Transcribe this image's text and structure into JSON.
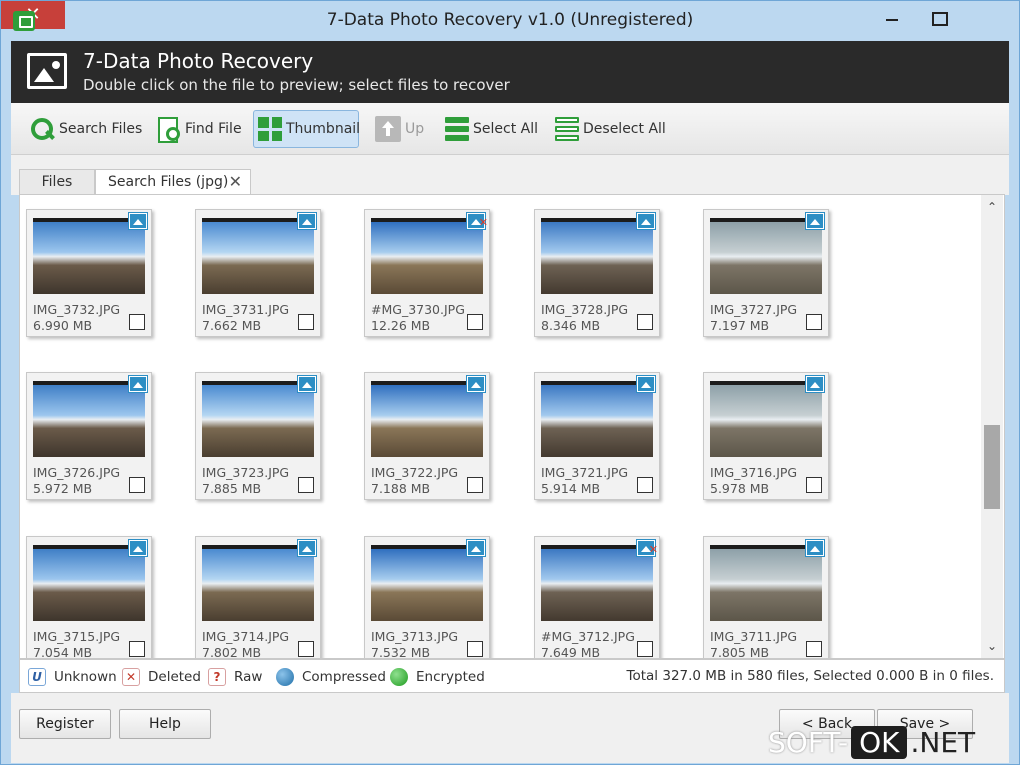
{
  "window": {
    "title": "7-Data Photo Recovery v1.0 (Unregistered)",
    "close_glyph": "✕"
  },
  "banner": {
    "title": "7-Data Photo Recovery",
    "subtitle": "Double click on the file to preview; select files to recover"
  },
  "toolbar": {
    "search_files": "Search Files",
    "find_file": "Find File",
    "thumbnail": "Thumbnail",
    "up": "Up",
    "select_all": "Select All",
    "deselect_all": "Deselect All"
  },
  "tabs": {
    "files": "Files",
    "search": "Search Files (jpg)",
    "close_glyph": "✕"
  },
  "thumbnails": [
    {
      "name": "IMG_3732.JPG",
      "size": "6.990 MB"
    },
    {
      "name": "IMG_3731.JPG",
      "size": "7.662 MB"
    },
    {
      "name": "#MG_3730.JPG",
      "size": "12.26 MB",
      "deleted": true
    },
    {
      "name": "IMG_3728.JPG",
      "size": "8.346 MB"
    },
    {
      "name": "IMG_3727.JPG",
      "size": "7.197 MB"
    },
    {
      "name": "IMG_3726.JPG",
      "size": "5.972 MB"
    },
    {
      "name": "IMG_3723.JPG",
      "size": "7.885 MB"
    },
    {
      "name": "IMG_3722.JPG",
      "size": "7.188 MB"
    },
    {
      "name": "IMG_3721.JPG",
      "size": "5.914 MB"
    },
    {
      "name": "IMG_3716.JPG",
      "size": "5.978 MB"
    },
    {
      "name": "IMG_3715.JPG",
      "size": "7.054 MB"
    },
    {
      "name": "IMG_3714.JPG",
      "size": "7.802 MB"
    },
    {
      "name": "IMG_3713.JPG",
      "size": "7.532 MB"
    },
    {
      "name": "#MG_3712.JPG",
      "size": "7.649 MB",
      "deleted": true
    },
    {
      "name": "IMG_3711.JPG",
      "size": "7.805 MB"
    }
  ],
  "legend": {
    "unknown_mark": "U",
    "unknown": "Unknown",
    "deleted_mark": "✕",
    "deleted": "Deleted",
    "raw_mark": "?",
    "raw": "Raw",
    "compressed": "Compressed",
    "encrypted": "Encrypted"
  },
  "status": {
    "total": "Total 327.0 MB in 580 files, Selected 0.000 B in 0 files."
  },
  "buttons": {
    "register": "Register",
    "help": "Help",
    "back": "< Back",
    "save": "Save >"
  },
  "watermark": {
    "soft": "SOFT-",
    "ok": "OK",
    "net": ".NET"
  },
  "scroll": {
    "up": "⌃",
    "down": "⌄"
  }
}
